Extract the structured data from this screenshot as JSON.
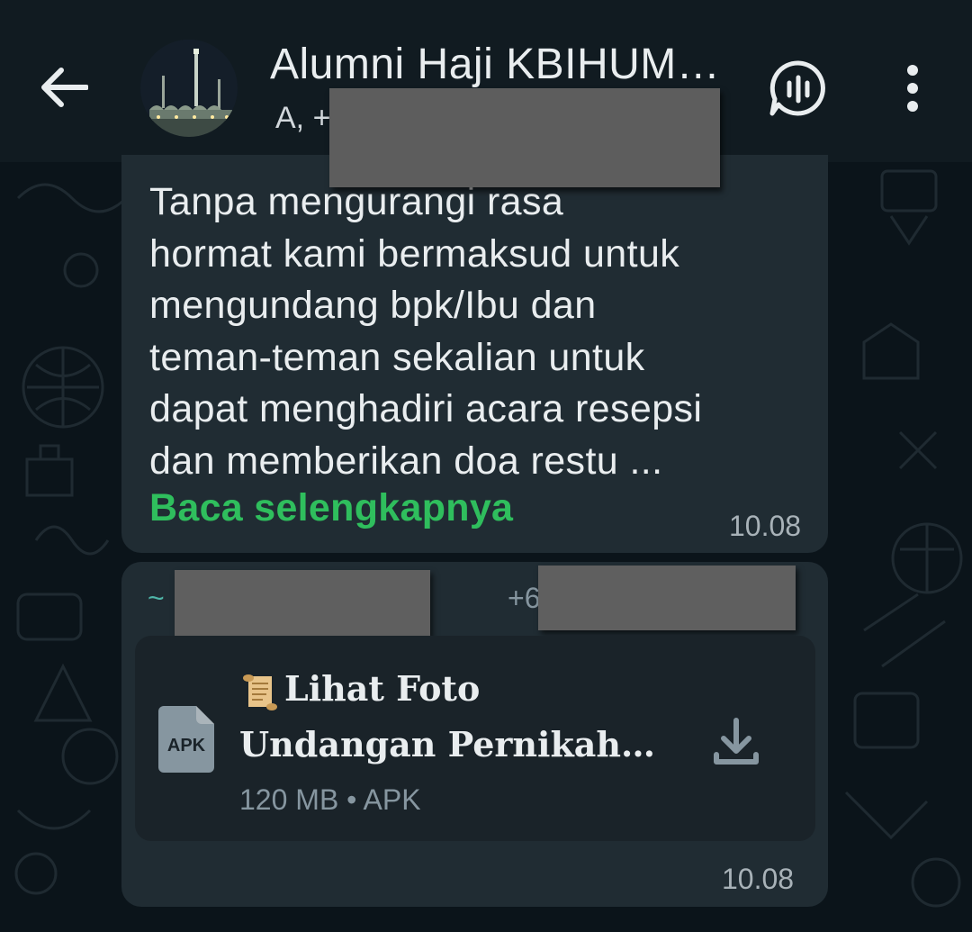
{
  "header": {
    "title": "Alumni Haji KBIHUM…",
    "subtitle": "A, +"
  },
  "messages": [
    {
      "lines": [
        "Tanpa mengurangi rasa",
        "hormat kami bermaksud untuk",
        "mengundang bpk/Ibu dan",
        "teman-teman sekalian untuk",
        "dapat menghadiri acara resepsi",
        "dan memberikan doa restu ..."
      ],
      "read_more": "Baca selengkapnya",
      "time": "10.08"
    },
    {
      "sender_prefix": "~",
      "sender_phone_prefix": "+6",
      "document": {
        "title_line1": "Lihat Foto",
        "title_line2": "Undangan Pernikaha…",
        "icon_label": "APK",
        "meta": "120 MB • APK"
      },
      "time": "10.08"
    }
  ],
  "colors": {
    "background": "#0b141a",
    "header": "#111b21",
    "bubble": "#202c33",
    "link_green": "#2fbe5d"
  }
}
